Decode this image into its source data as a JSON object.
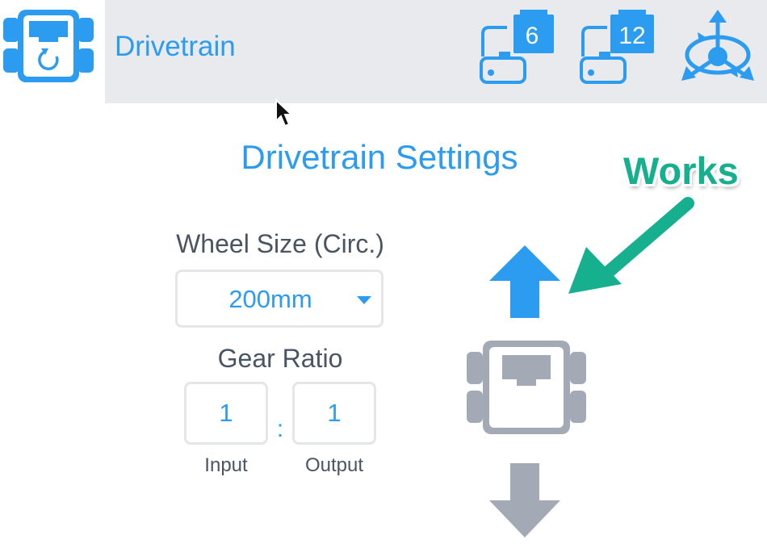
{
  "header": {
    "app_icon": "drivetrain-app-icon",
    "title": "Drivetrain",
    "devices": [
      {
        "icon": "motor-port-icon",
        "port": "6"
      },
      {
        "icon": "motor-port-icon",
        "port": "12"
      }
    ],
    "gyro_icon": "gyro-sensor-icon"
  },
  "settings": {
    "title": "Drivetrain Settings",
    "wheel_size": {
      "label": "Wheel Size (Circ.)",
      "value": "200mm"
    },
    "gear_ratio": {
      "label": "Gear Ratio",
      "input_value": "1",
      "output_value": "1",
      "separator": ":",
      "input_caption": "Input",
      "output_caption": "Output"
    }
  },
  "controls": {
    "forward_icon": "arrow-up-icon",
    "robot_icon": "robot-icon",
    "reverse_icon": "arrow-down-icon"
  },
  "annotation": {
    "text": "Works"
  },
  "colors": {
    "accent": "#2c9cf0",
    "header_bg": "#e9eaee",
    "label_text": "#4a5564",
    "disabled_gray": "#a3aab6",
    "annotation_green": "#17b08f"
  }
}
